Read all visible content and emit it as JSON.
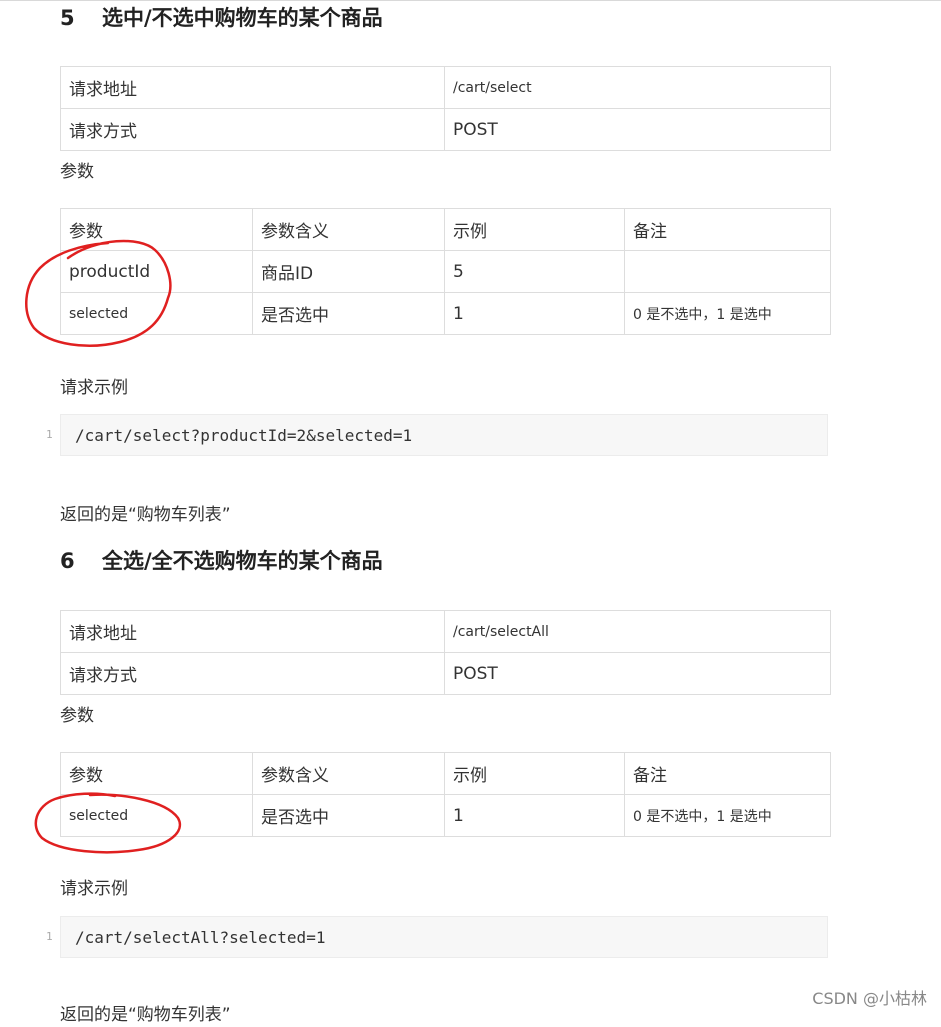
{
  "section5": {
    "number": "5",
    "title": "选中/不选中购物车的某个商品",
    "request_table": [
      {
        "key": "请求地址",
        "value": "/cart/select"
      },
      {
        "key": "请求方式",
        "value": "POST"
      }
    ],
    "params_label": "参数",
    "params_headers": [
      "参数",
      "参数含义",
      "示例",
      "备注"
    ],
    "params_rows": [
      [
        "productId",
        "商品ID",
        "5",
        ""
      ],
      [
        "selected",
        "是否选中",
        "1",
        "0 是不选中，1 是选中"
      ]
    ],
    "example_label": "请求示例",
    "code_line_number": "1",
    "code": "/cart/select?productId=2&selected=1",
    "return_text": "返回的是“购物车列表”"
  },
  "section6": {
    "number": "6",
    "title": "全选/全不选购物车的某个商品",
    "request_table": [
      {
        "key": "请求地址",
        "value": "/cart/selectAll"
      },
      {
        "key": "请求方式",
        "value": "POST"
      }
    ],
    "params_label": "参数",
    "params_headers": [
      "参数",
      "参数含义",
      "示例",
      "备注"
    ],
    "params_rows": [
      [
        "selected",
        "是否选中",
        "1",
        "0 是不选中，1 是选中"
      ]
    ],
    "example_label": "请求示例",
    "code_line_number": "1",
    "code": "/cart/selectAll?selected=1",
    "return_text": "返回的是“购物车列表”"
  },
  "watermark": "CSDN @小枯林",
  "colors": {
    "annotation": "#e02020",
    "border": "#dddddd",
    "code_bg": "#f7f7f7"
  }
}
